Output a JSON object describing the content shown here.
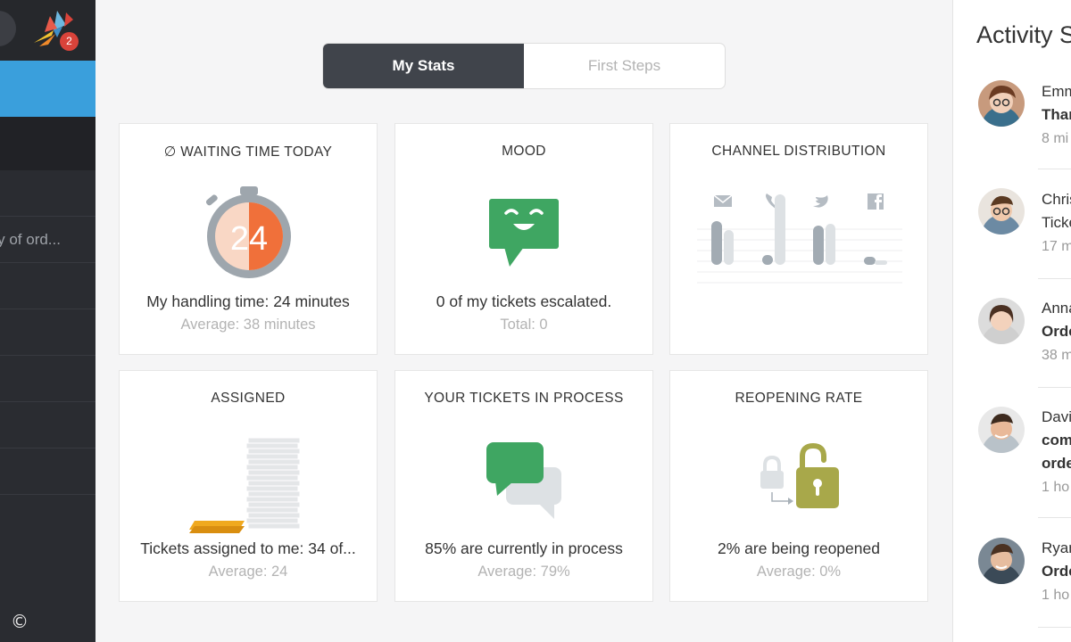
{
  "sidebar": {
    "badge_count": "2",
    "items": [
      {
        "label": ""
      },
      {
        "label": "ery of ord..."
      },
      {
        "label": ""
      },
      {
        "label": "."
      },
      {
        "label": ""
      },
      {
        "label": ""
      },
      {
        "label": ""
      }
    ],
    "copyright_symbol": "©"
  },
  "tabs": [
    {
      "label": "My Stats",
      "active": true
    },
    {
      "label": "First Steps",
      "active": false
    }
  ],
  "cards": {
    "waiting": {
      "title": "∅ WAITING TIME TODAY",
      "value": "24",
      "main": "My handling time: 24 minutes",
      "sub": "Average: 38 minutes"
    },
    "mood": {
      "title": "MOOD",
      "main": "0 of my tickets escalated.",
      "sub": "Total: 0"
    },
    "channel": {
      "title": "CHANNEL DISTRIBUTION",
      "channels": [
        "email-icon",
        "phone-icon",
        "twitter-icon",
        "facebook-icon"
      ]
    },
    "assigned": {
      "title": "ASSIGNED",
      "main": "Tickets assigned to me: 34 of...",
      "sub": "Average: 24"
    },
    "in_process": {
      "title": "YOUR TICKETS IN PROCESS",
      "main": "85% are currently in process",
      "sub": "Average: 79%"
    },
    "reopening": {
      "title": "REOPENING RATE",
      "main": "2% are being reopened",
      "sub": "Average: 0%"
    }
  },
  "activity": {
    "title": "Activity S",
    "entries": [
      {
        "line1": "Emm",
        "line2": "Thar",
        "line3": "8 mi"
      },
      {
        "line1": "Chris",
        "line2": "Ticke",
        "line3": "17 m"
      },
      {
        "line1": "Anna",
        "line2": "Orde",
        "line3": "38 m"
      },
      {
        "line1": "Davi",
        "line2": "com",
        "line2b": "orde",
        "line3": "1 ho"
      },
      {
        "line1": "Ryan",
        "line2": "Orde",
        "line3": "1 ho"
      }
    ]
  },
  "colors": {
    "sidebar": "#2a2c31",
    "sidebar_active": "#3a9fdc",
    "tab_active": "#40444b",
    "green": "#3fa662",
    "orange": "#f0703a",
    "olive": "#a8a84a",
    "gold": "#f0a91e"
  }
}
